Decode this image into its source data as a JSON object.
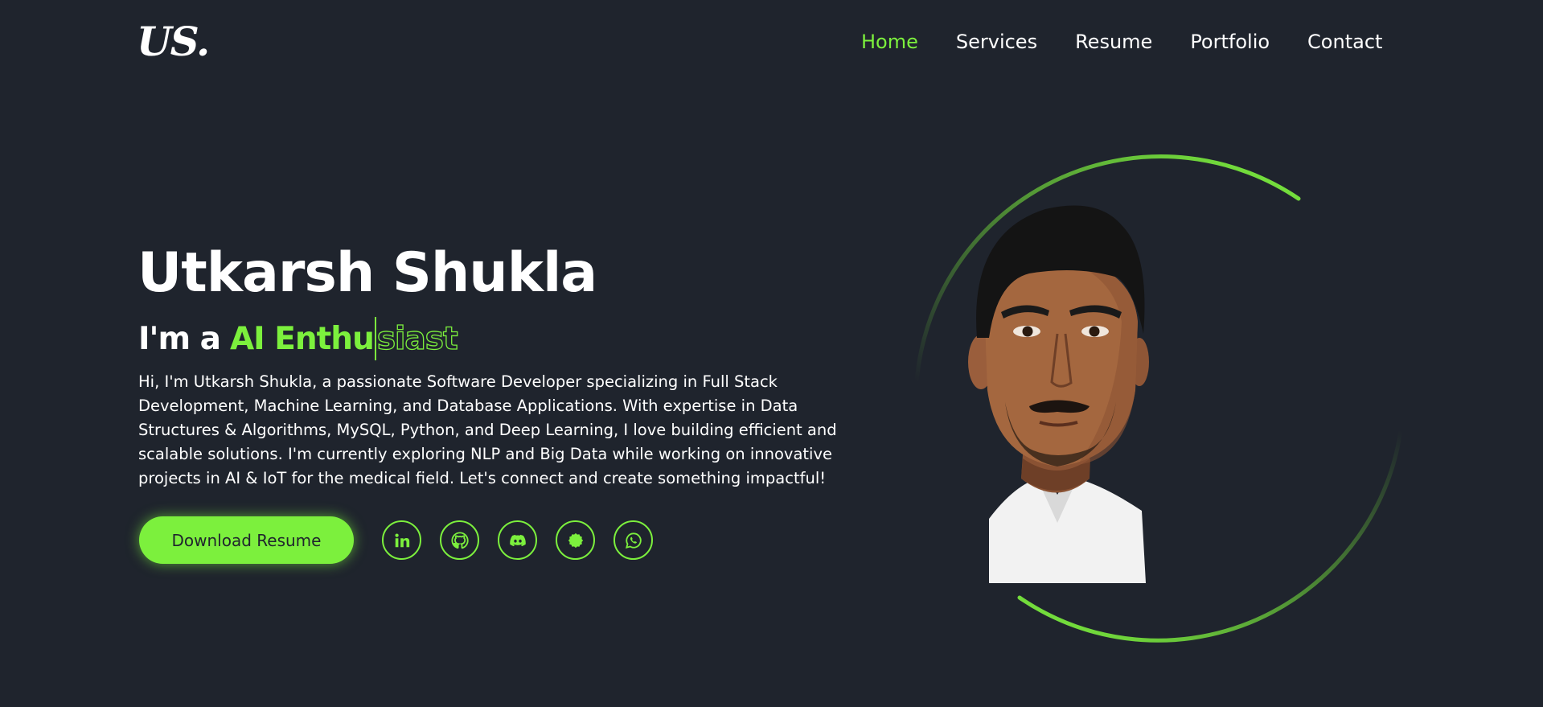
{
  "header": {
    "logo": "US.",
    "nav": [
      {
        "label": "Home",
        "active": true
      },
      {
        "label": "Services",
        "active": false
      },
      {
        "label": "Resume",
        "active": false
      },
      {
        "label": "Portfolio",
        "active": false
      },
      {
        "label": "Contact",
        "active": false
      }
    ]
  },
  "hero": {
    "name": "Utkarsh Shukla",
    "tagline_prefix": "I'm a",
    "tagline_typed": "AI Enthu",
    "tagline_remaining": "siast",
    "bio": "Hi, I'm Utkarsh Shukla, a passionate Software Developer specializing in Full Stack Development, Machine Learning, and Database Applications. With expertise in Data Structures & Algorithms, MySQL, Python, and Deep Learning, I love building efficient and scalable solutions. I'm currently exploring NLP and Big Data while working on innovative projects in AI & IoT for the medical field. Let's connect and create something impactful!",
    "download_label": "Download Resume",
    "socials": [
      {
        "icon": "linkedin-icon"
      },
      {
        "icon": "github-icon"
      },
      {
        "icon": "discord-icon"
      },
      {
        "icon": "badge-icon"
      },
      {
        "icon": "whatsapp-icon"
      }
    ]
  },
  "colors": {
    "background": "#1f242d",
    "accent": "#7cf03d",
    "text": "#ffffff"
  }
}
